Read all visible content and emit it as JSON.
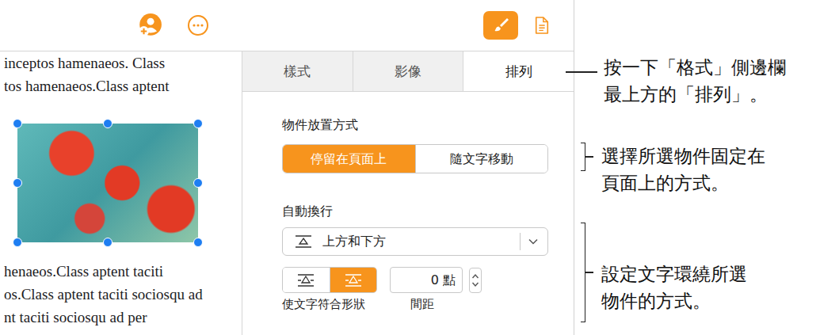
{
  "toolbar": {
    "inspector_buttons": [
      {
        "name": "format",
        "selected": true
      },
      {
        "name": "document",
        "selected": false
      }
    ]
  },
  "document": {
    "lines_above": [
      "inceptos hamenaeos. Class",
      "tos hamenaeos.Class aptent"
    ],
    "image": {
      "selected": true
    },
    "lines_below": [
      "henaeos.Class aptent taciti",
      "os.Class aptent taciti sociosqu ad",
      "nt taciti sociosqu ad per"
    ]
  },
  "sidebar": {
    "tabs": [
      {
        "label": "樣式",
        "selected": false
      },
      {
        "label": "影像",
        "selected": false
      },
      {
        "label": "排列",
        "selected": true
      }
    ],
    "placement": {
      "label": "物件放置方式",
      "options": [
        {
          "label": "停留在頁面上",
          "selected": true
        },
        {
          "label": "隨文字移動",
          "selected": false
        }
      ]
    },
    "wrap": {
      "label": "自動換行",
      "dropdown": {
        "value": "上方和下方"
      },
      "fit_buttons": [
        {
          "selected": false
        },
        {
          "selected": true
        }
      ],
      "fit_label": "使文字符合形狀",
      "spacing": {
        "value": "0 點",
        "label": "間距"
      }
    }
  },
  "callouts": [
    {
      "kind": "line",
      "lines": [
        "按一下「格式」側邊欄",
        "最上方的「排列」。"
      ]
    },
    {
      "kind": "bracket",
      "lines": [
        "選擇所選物件固定在",
        "頁面上的方式。"
      ]
    },
    {
      "kind": "bracket",
      "lines": [
        "設定文字環繞所選",
        "物件的方式。"
      ]
    }
  ]
}
